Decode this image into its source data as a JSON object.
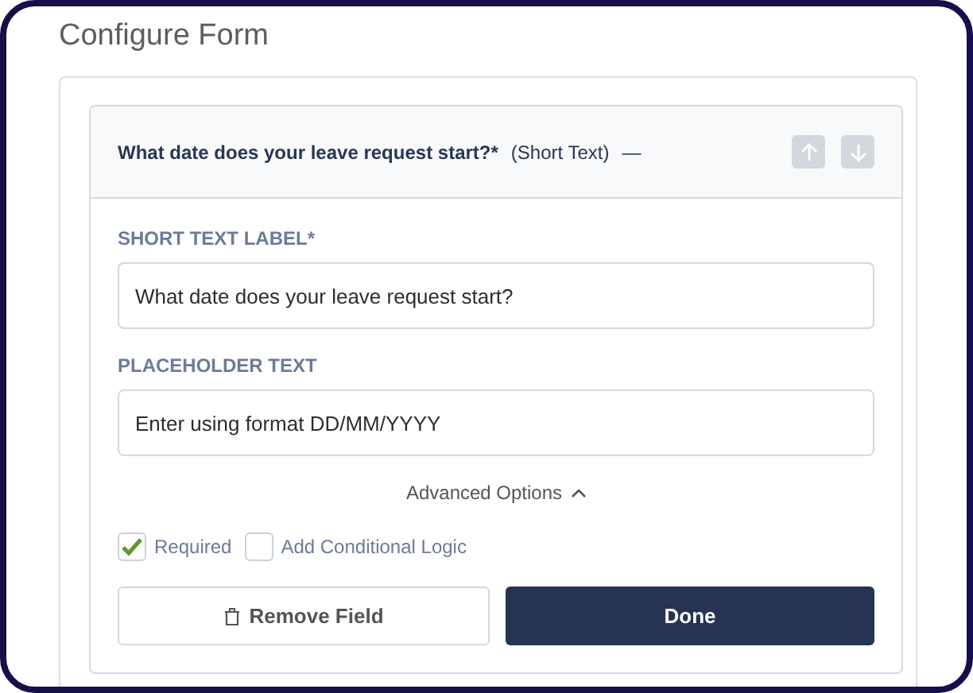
{
  "title": "Configure Form",
  "field": {
    "question": "What date does your leave request start?*",
    "type": "(Short Text)",
    "collapse_symbol": "—"
  },
  "inputs": [
    {
      "label": "SHORT TEXT LABEL*",
      "value": "What date does your leave request start?"
    },
    {
      "label": "PLACEHOLDER TEXT",
      "value": "Enter using format DD/MM/YYYY"
    }
  ],
  "advanced": {
    "label": "Advanced Options",
    "expanded": true
  },
  "options": [
    {
      "label": "Required",
      "checked": true
    },
    {
      "label": "Add Conditional Logic",
      "checked": false
    }
  ],
  "buttons": {
    "remove": "Remove Field",
    "done": "Done"
  }
}
